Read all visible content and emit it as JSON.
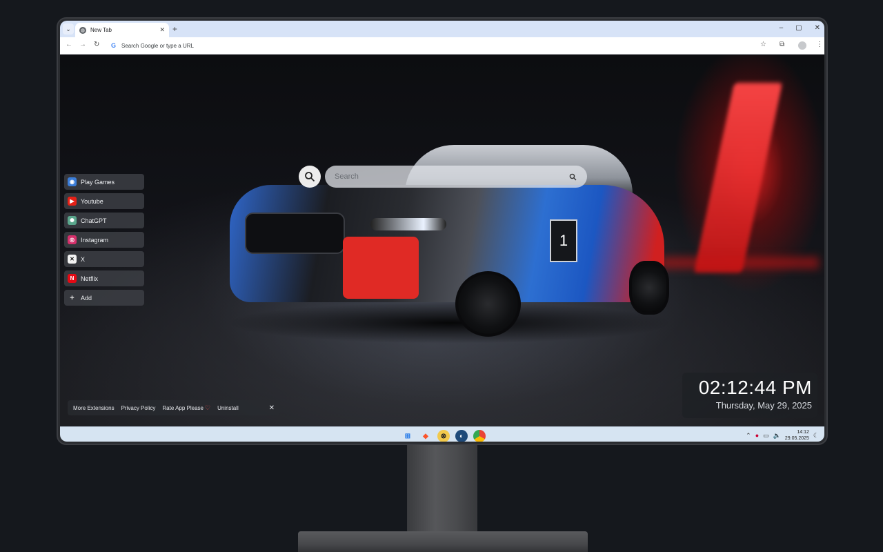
{
  "browser": {
    "tab_title": "New Tab",
    "new_tab_symbol": "+",
    "omnibox_placeholder": "Search Google or type a URL",
    "window_controls": [
      "–",
      "▢",
      "✕"
    ]
  },
  "search": {
    "placeholder": "Search"
  },
  "shortcuts": [
    {
      "label": "Play Games",
      "icon": "games-icon",
      "color": "#3b7dd8"
    },
    {
      "label": "Youtube",
      "icon": "youtube-icon",
      "color": "#e62117"
    },
    {
      "label": "ChatGPT",
      "icon": "chatgpt-icon",
      "color": "#5aa68c"
    },
    {
      "label": "Instagram",
      "icon": "instagram-icon",
      "color": "#d6306b"
    },
    {
      "label": "X",
      "icon": "x-icon",
      "color": "#f2f2f2"
    },
    {
      "label": "Netflix",
      "icon": "netflix-icon",
      "color": "#e50914"
    },
    {
      "label": "Add",
      "icon": "plus-icon",
      "color": "#00000000"
    }
  ],
  "footer": {
    "more_extensions": "More Extensions",
    "privacy_policy": "Privacy Policy",
    "rate_app": "Rate App Please",
    "uninstall": "Uninstall"
  },
  "clock": {
    "time": "02:12:44 PM",
    "date": "Thursday, May 29, 2025"
  },
  "taskbar": {
    "time": "14:12",
    "date": "29.05.2025"
  },
  "colors": {
    "accent_red": "#e02a25",
    "accent_blue": "#2f66c9"
  }
}
